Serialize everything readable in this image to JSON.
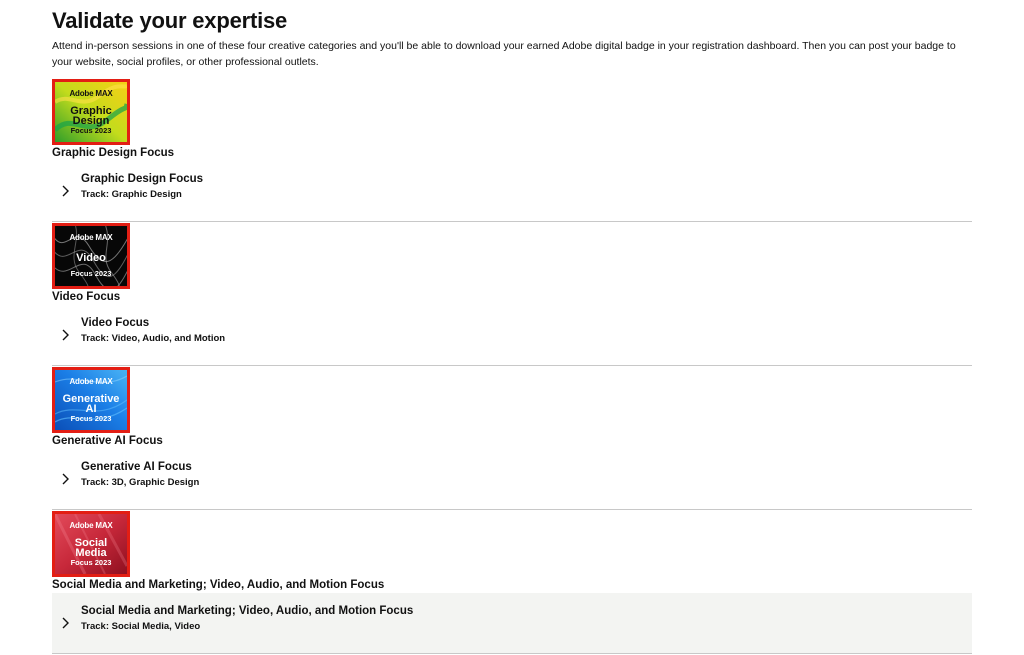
{
  "header": {
    "title": "Validate your expertise",
    "intro": "Attend in-person sessions in one of these four creative categories and you'll be able to download your earned Adobe digital badge in your registration dashboard. Then you can post your badge to your website, social profiles, or other professional outlets."
  },
  "sections": [
    {
      "badge": {
        "brand": "Adobe MAX",
        "name": "Graphic\nDesign",
        "year": "Focus 2023",
        "colors": [
          "#2f9e2a",
          "#d6e21a",
          "#f6cf16"
        ]
      },
      "title": "Graphic Design Focus",
      "item": {
        "title": "Graphic Design Focus",
        "track": "Track: Graphic Design"
      }
    },
    {
      "badge": {
        "brand": "Adobe MAX",
        "name": "Video",
        "year": "Focus 2023",
        "colors": [
          "#050505",
          "#2a2a2a",
          "#111111"
        ]
      },
      "title": "Video Focus",
      "item": {
        "title": "Video Focus",
        "track": "Track: Video, Audio, and Motion"
      }
    },
    {
      "badge": {
        "brand": "Adobe MAX",
        "name": "Generative\nAI",
        "year": "Focus 2023",
        "colors": [
          "#0b4fb8",
          "#1b7ee6",
          "#3aa6f2"
        ]
      },
      "title": "Generative AI Focus",
      "item": {
        "title": "Generative AI Focus",
        "track": "Track: 3D, Graphic Design"
      }
    },
    {
      "badge": {
        "brand": "Adobe MAX",
        "name": "Social\nMedia",
        "year": "Focus 2023",
        "colors": [
          "#8f1020",
          "#c7283a",
          "#e24a5a"
        ]
      },
      "title": "Social Media and Marketing; Video, Audio, and Motion Focus",
      "item": {
        "title": "Social Media and Marketing; Video, Audio, and Motion Focus",
        "track": "Track: Social Media, Video"
      }
    }
  ],
  "icons": {
    "row_expand": "chevron-right-icon"
  },
  "colors": {
    "badge_border": "#e31e14",
    "divider": "#c8c8c8",
    "hover_row": "#f3f4f2"
  }
}
